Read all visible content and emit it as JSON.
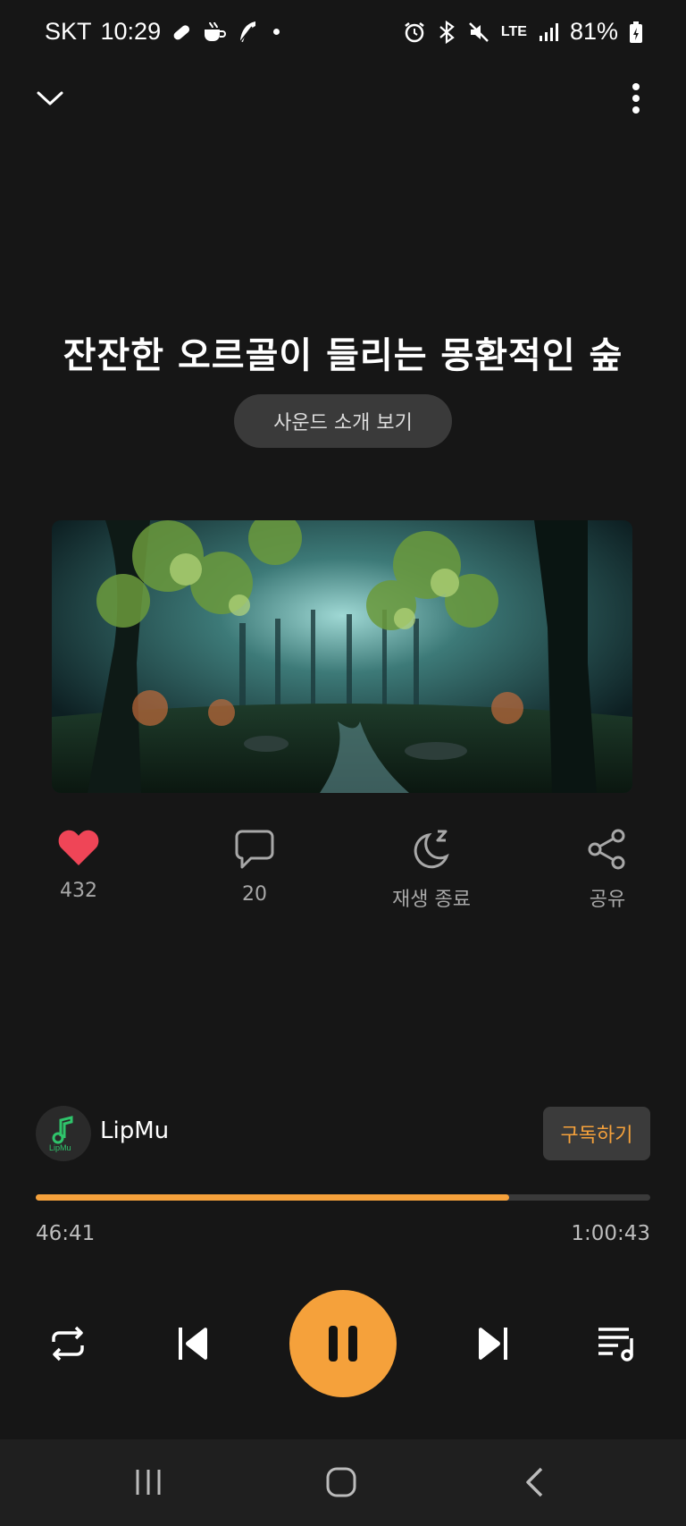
{
  "status": {
    "carrier": "SKT",
    "time": "10:29",
    "network": "LTE",
    "battery": "81%"
  },
  "track": {
    "title": "잔잔한 오르골이 들리는 몽환적인 숲",
    "intro_label": "사운드 소개 보기"
  },
  "actions": {
    "likes": "432",
    "comments": "20",
    "sleep_label": "재생 종료",
    "share_label": "공유"
  },
  "channel": {
    "name": "LipMu",
    "avatar_text": "LipMu",
    "subscribe_label": "구독하기"
  },
  "progress": {
    "elapsed": "46:41",
    "total": "1:00:43",
    "fraction": 0.77
  },
  "colors": {
    "accent": "#f5a13b",
    "like": "#ef4557",
    "background": "#161616"
  }
}
